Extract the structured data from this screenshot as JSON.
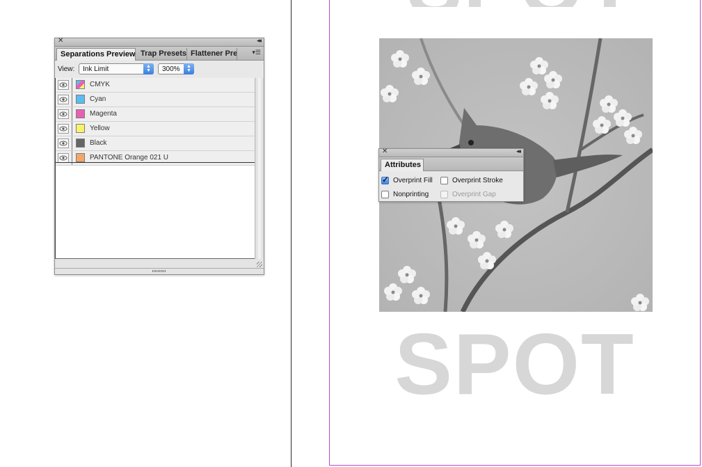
{
  "document": {
    "big_text_top": "SPOT",
    "big_text_bottom": "SPOT"
  },
  "separations_panel": {
    "tabs": [
      {
        "label": "Separations Preview",
        "active": true
      },
      {
        "label": "Trap Presets",
        "active": false
      },
      {
        "label": "Flattener Pre",
        "active": false
      }
    ],
    "view_label": "View:",
    "view_value": "Ink Limit",
    "ink_limit_value": "300%",
    "inks": [
      {
        "name": "CMYK",
        "color": "multicolor"
      },
      {
        "name": "Cyan",
        "color": "#5bbcf0"
      },
      {
        "name": "Magenta",
        "color": "#e860b4"
      },
      {
        "name": "Yellow",
        "color": "#f9f36a"
      },
      {
        "name": "Black",
        "color": "#666666"
      },
      {
        "name": "PANTONE Orange 021 U",
        "color": "#f2a66a"
      }
    ]
  },
  "attributes_panel": {
    "tab_label": "Attributes",
    "options": {
      "overprint_fill": {
        "label": "Overprint Fill",
        "checked": true,
        "enabled": true
      },
      "overprint_stroke": {
        "label": "Overprint Stroke",
        "checked": false,
        "enabled": true
      },
      "nonprinting": {
        "label": "Nonprinting",
        "checked": false,
        "enabled": true
      },
      "overprint_gap": {
        "label": "Overprint Gap",
        "checked": false,
        "enabled": false
      }
    }
  },
  "colors": {
    "page_border": "#b04fc8",
    "select_accent": "#3a7fe0"
  }
}
